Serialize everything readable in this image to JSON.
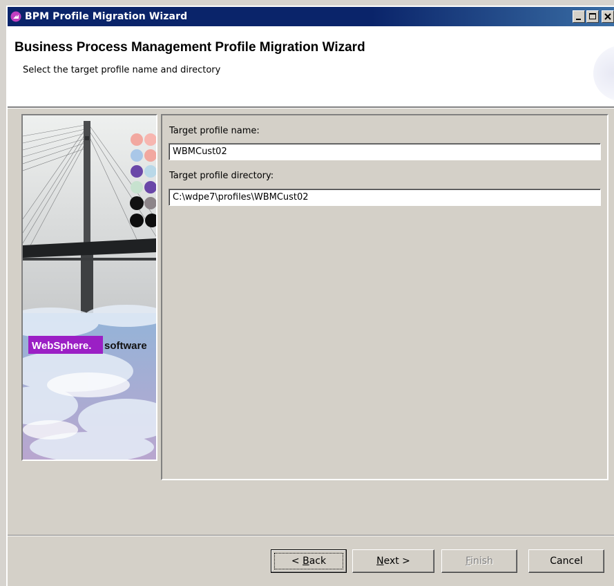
{
  "window": {
    "title": "BPM Profile Migration Wizard",
    "controls": {
      "minimize": "minimize-icon",
      "maximize": "maximize-icon",
      "close": "close-icon"
    }
  },
  "header": {
    "title": "Business Process Management Profile Migration Wizard",
    "subtitle": "Select the target profile name and directory"
  },
  "banner": {
    "brand": "WebSphere.",
    "suffix": "software",
    "brand_color": "#9b1fc5"
  },
  "form": {
    "profile_name_label": "Target profile name:",
    "profile_name_value": "WBMCust02",
    "profile_dir_label": "Target profile directory:",
    "profile_dir_value": "C:\\wdpe7\\profiles\\WBMCust02"
  },
  "buttons": {
    "back": {
      "prefix": "< ",
      "mnemonic": "B",
      "rest": "ack"
    },
    "next": {
      "mnemonic": "N",
      "rest": "ext >"
    },
    "finish": {
      "mnemonic": "F",
      "rest": "inish"
    },
    "cancel": {
      "label": "Cancel"
    }
  },
  "colors": {
    "titlebar": "#0a246a",
    "dialog_bg": "#d4d0c8"
  }
}
